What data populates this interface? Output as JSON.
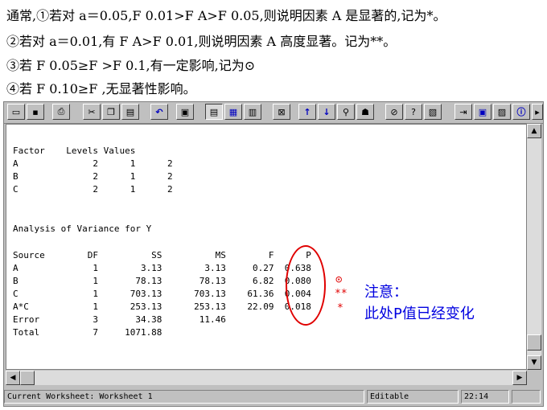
{
  "notes": {
    "line1": "通常,①若对 a＝0.05,F 0.01>F A>F 0.05,则说明因素 A 是显著的,记为*。",
    "line2": "②若对 a＝0.01,有 F A>F 0.01,则说明因素 A 高度显著。记为**。",
    "line3": "③若 F 0.05≥F >F 0.1,有一定影响,记为⊙",
    "line4": "④若 F 0.10≥F ,无显著性影响。"
  },
  "toolbar": {
    "icons": [
      "open-icon",
      "save-icon",
      "print-icon",
      "cut-icon",
      "copy-icon",
      "paste-icon",
      "undo-icon",
      "edit-last-dialog-icon",
      "session-window-icon",
      "data-window-icon",
      "info-window-icon",
      "delete-icon",
      "up-arrow-icon",
      "down-arrow-icon",
      "find-icon",
      "help-man-icon",
      "cancel-icon",
      "help-icon",
      "manage-graphs-icon",
      "project-manager-icon",
      "window-icon",
      "tile-icon",
      "info-icon"
    ]
  },
  "session": {
    "factor_table": "Factor    Levels Values\nA              2      1      2\nB              2      1      2\nC              2      1      2",
    "anova_title": "Analysis of Variance for Y",
    "anova_table": "Source        DF          SS          MS        F      P\nA              1        3.13        3.13     0.27  0.638\nB              1       78.13       78.13     6.82  0.080\nC              1      703.13      703.13    61.36  0.004\nA*C            1      253.13      253.13    22.09  0.018\nError          3       34.38       11.46\nTotal          7     1071.88"
  },
  "annotations": {
    "mark_b": "⊙",
    "mark_c": "**",
    "mark_ac": "*",
    "note_line1": "注意：",
    "note_line2": "此处P值已经变化"
  },
  "statusbar": {
    "worksheet": "Current Worksheet: Worksheet 1",
    "mode": "Editable",
    "time": "22:14"
  },
  "colors": {
    "annotation_red": "#e00000",
    "annotation_blue": "#0000e0",
    "chrome": "#c0c0c0"
  }
}
